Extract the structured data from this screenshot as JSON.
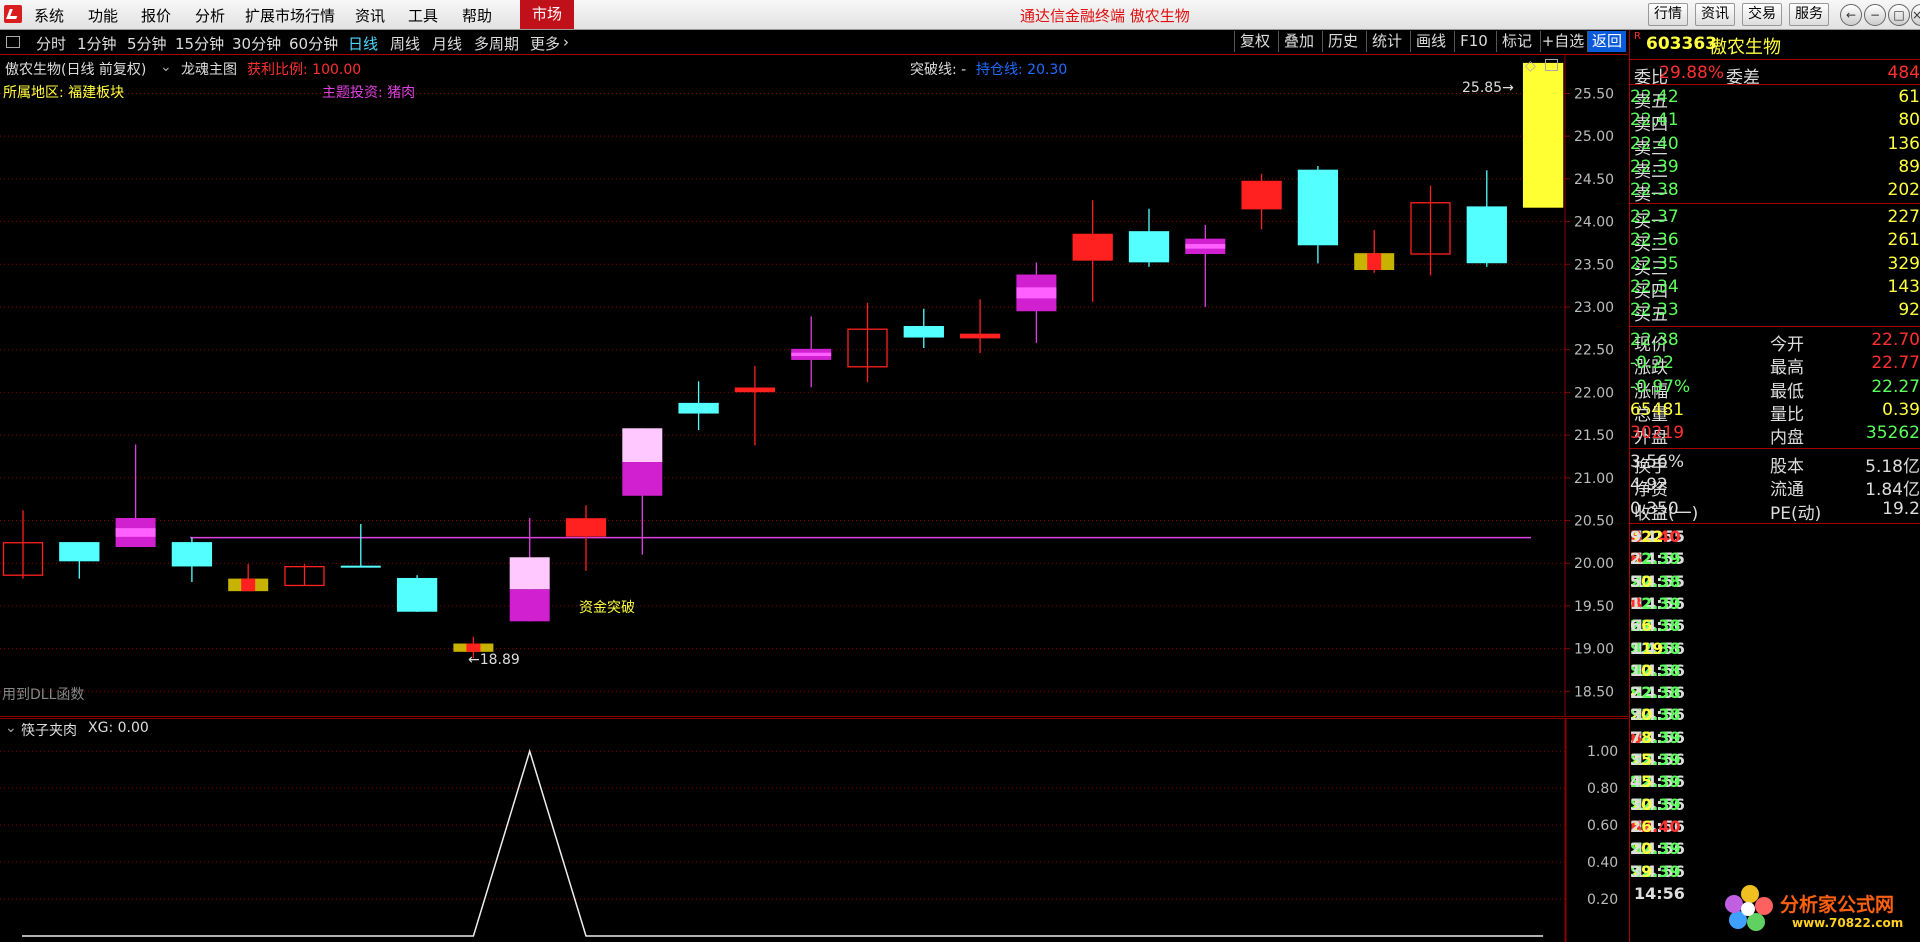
{
  "menu": {
    "items": [
      "系统",
      "功能",
      "报价",
      "分析",
      "扩展市场行情",
      "资讯",
      "工具",
      "帮助"
    ],
    "market_tab": "市场"
  },
  "app_title": "通达信金融终端  傲农生物",
  "top_right_buttons": [
    "行情",
    "资讯",
    "交易",
    "服务"
  ],
  "period_toolbar": {
    "items": [
      "分时",
      "1分钟",
      "5分钟",
      "15分钟",
      "30分钟",
      "60分钟",
      "日线",
      "周线",
      "月线",
      "多周期",
      "更多"
    ],
    "active": "日线"
  },
  "tool_buttons": {
    "items": [
      "复权",
      "叠加",
      "历史",
      "统计",
      "画线",
      "F10",
      "标记",
      "+自选",
      "返回"
    ],
    "active": "返回"
  },
  "chart_header": {
    "stock": "傲农生物(日线 前复权)",
    "main_formula": "龙魂主图",
    "profit_label": "获利比例: 100.00",
    "breakout_label": "突破线: -",
    "hold_label": "持仓线: 20.30",
    "region": "所属地区: 福建板块",
    "theme": "主题投资: 猪肉"
  },
  "annotations": {
    "capital_breakout": "资金突破",
    "low_marker": "←18.89",
    "high_marker": "25.85→",
    "dll_note": "用到DLL函数"
  },
  "subchart": {
    "name": "筷子夹肉",
    "value_label": "XG: 0.00"
  },
  "colors": {
    "up": "#ff2020",
    "down": "#54ffff",
    "magenta": "#e040e0",
    "yellow": "#ffff33",
    "grid": "#8b0000"
  },
  "chart_data": [
    {
      "type": "candlestick",
      "ylim": [
        18.2,
        25.95
      ],
      "yticks": [
        "25.50",
        "25.00",
        "24.50",
        "24.00",
        "23.50",
        "23.00",
        "22.50",
        "22.00",
        "21.50",
        "21.00",
        "20.50",
        "20.00",
        "19.50",
        "19.00",
        "18.50"
      ],
      "hold_line": 20.3,
      "candles": [
        {
          "o": 19.86,
          "c": 20.24,
          "h": 20.62,
          "l": 19.82,
          "style": "up-hollow"
        },
        {
          "o": 20.24,
          "c": 20.03,
          "h": 20.24,
          "l": 19.82,
          "style": "cyan"
        },
        {
          "o": 20.19,
          "c": 20.53,
          "h": 21.39,
          "l": 20.19,
          "style": "magenta"
        },
        {
          "o": 20.24,
          "c": 19.97,
          "h": 20.3,
          "l": 19.78,
          "style": "cyan"
        },
        {
          "o": 19.72,
          "c": 19.82,
          "h": 19.99,
          "l": 19.72,
          "style": "yellow-red"
        },
        {
          "o": 19.74,
          "c": 19.96,
          "h": 19.99,
          "l": 19.74,
          "style": "up-hollow"
        },
        {
          "o": 19.96,
          "c": 19.96,
          "h": 20.46,
          "l": 19.96,
          "style": "cyan-doji"
        },
        {
          "o": 19.82,
          "c": 19.44,
          "h": 19.86,
          "l": 19.43,
          "style": "cyan"
        },
        {
          "o": 19.01,
          "c": 19.06,
          "h": 19.14,
          "l": 18.89,
          "style": "yellow-red"
        },
        {
          "o": 19.32,
          "c": 20.07,
          "h": 20.53,
          "l": 19.32,
          "style": "pink-magenta"
        },
        {
          "o": 20.32,
          "c": 20.52,
          "h": 20.68,
          "l": 19.91,
          "style": "up"
        },
        {
          "o": 20.79,
          "c": 21.58,
          "h": 21.58,
          "l": 20.1,
          "style": "pink-magenta"
        },
        {
          "o": 21.87,
          "c": 21.76,
          "h": 22.13,
          "l": 21.56,
          "style": "cyan"
        },
        {
          "o": 22.01,
          "c": 22.05,
          "h": 22.31,
          "l": 21.38,
          "style": "up"
        },
        {
          "o": 22.38,
          "c": 22.51,
          "h": 22.89,
          "l": 22.06,
          "style": "magenta"
        },
        {
          "o": 22.3,
          "c": 22.74,
          "h": 23.05,
          "l": 22.12,
          "style": "up-hollow"
        },
        {
          "o": 22.77,
          "c": 22.65,
          "h": 22.98,
          "l": 22.52,
          "style": "cyan"
        },
        {
          "o": 22.64,
          "c": 22.68,
          "h": 23.09,
          "l": 22.46,
          "style": "up"
        },
        {
          "o": 22.95,
          "c": 23.38,
          "h": 23.52,
          "l": 22.58,
          "style": "magenta"
        },
        {
          "o": 23.55,
          "c": 23.85,
          "h": 24.25,
          "l": 23.06,
          "style": "up"
        },
        {
          "o": 23.88,
          "c": 23.53,
          "h": 24.15,
          "l": 23.47,
          "style": "cyan"
        },
        {
          "o": 23.62,
          "c": 23.8,
          "h": 23.96,
          "l": 23.0,
          "style": "magenta"
        },
        {
          "o": 24.15,
          "c": 24.47,
          "h": 24.56,
          "l": 23.91,
          "style": "up"
        },
        {
          "o": 24.6,
          "c": 23.73,
          "h": 24.65,
          "l": 23.51,
          "style": "cyan"
        },
        {
          "o": 23.48,
          "c": 23.63,
          "h": 23.9,
          "l": 23.4,
          "style": "yellow-red"
        },
        {
          "o": 23.62,
          "c": 24.22,
          "h": 24.42,
          "l": 23.37,
          "style": "up-hollow"
        },
        {
          "o": 24.17,
          "c": 23.52,
          "h": 24.6,
          "l": 23.47,
          "style": "cyan"
        },
        {
          "o": 24.17,
          "c": 25.85,
          "h": 25.85,
          "l": 24.17,
          "style": "yellow"
        }
      ]
    },
    {
      "type": "line",
      "series": [
        {
          "name": "XG",
          "values": [
            0,
            0,
            0,
            0,
            0,
            0,
            0,
            0,
            0,
            1,
            0,
            0,
            0,
            0,
            0,
            0,
            0,
            0,
            0,
            0,
            0,
            0,
            0,
            0,
            0,
            0,
            0,
            0
          ]
        }
      ],
      "ylim": [
        0,
        1.05
      ],
      "yticks": [
        "1.00",
        "0.80",
        "0.60",
        "0.40",
        "0.20"
      ]
    }
  ],
  "quote": {
    "code": "603363",
    "name": "傲农生物",
    "ratio": {
      "label": "委比",
      "value": "29.88%",
      "diff_label": "委差",
      "diff_value": "484"
    },
    "sells": [
      {
        "label": "卖五",
        "price": "22.42",
        "vol": "61"
      },
      {
        "label": "卖四",
        "price": "22.41",
        "vol": "80"
      },
      {
        "label": "卖三",
        "price": "22.40",
        "vol": "136"
      },
      {
        "label": "卖二",
        "price": "22.39",
        "vol": "89"
      },
      {
        "label": "卖一",
        "price": "22.38",
        "vol": "202"
      }
    ],
    "buys": [
      {
        "label": "买一",
        "price": "22.37",
        "vol": "227"
      },
      {
        "label": "买二",
        "price": "22.36",
        "vol": "261"
      },
      {
        "label": "买三",
        "price": "22.35",
        "vol": "329"
      },
      {
        "label": "买四",
        "price": "22.34",
        "vol": "143"
      },
      {
        "label": "买五",
        "price": "22.33",
        "vol": "92"
      }
    ],
    "stats": [
      {
        "l1": "现价",
        "v1": "22.38",
        "c1": "#5cff5c",
        "l2": "今开",
        "v2": "22.70",
        "c2": "#ff3030"
      },
      {
        "l1": "涨跌",
        "v1": "-0.22",
        "c1": "#5cff5c",
        "l2": "最高",
        "v2": "22.77",
        "c2": "#ff3030"
      },
      {
        "l1": "涨幅",
        "v1": "-0.97%",
        "c1": "#5cff5c",
        "l2": "最低",
        "v2": "22.27",
        "c2": "#5cff5c"
      },
      {
        "l1": "总量",
        "v1": "65481",
        "c1": "#ffff40",
        "l2": "量比",
        "v2": "0.39",
        "c2": "#ffff40"
      },
      {
        "l1": "外盘",
        "v1": "30219",
        "c1": "#ff3030",
        "l2": "内盘",
        "v2": "35262",
        "c2": "#5cff5c"
      }
    ],
    "fund": [
      {
        "l1": "换手",
        "v1": "3.56%",
        "l2": "股本",
        "v2": "5.18亿"
      },
      {
        "l1": "净资",
        "v1": "4.92",
        "l2": "流通",
        "v2": "1.84亿"
      },
      {
        "l1": "收益(一)",
        "v1": "0.350",
        "l2": "PE(动)",
        "v2": "19.2"
      }
    ],
    "ticks": [
      {
        "t": "14:55",
        "p": "22.40",
        "v": "122",
        "s": "B",
        "n": "9"
      },
      {
        "t": "14:55",
        "p": "22.39",
        "v": "3",
        "s": "B",
        "n": "2"
      },
      {
        "t": "14:55",
        "p": "22.38",
        "v": "50",
        "s": "S",
        "n": "5"
      },
      {
        "t": "14:56",
        "p": "22.39",
        "v": "6",
        "s": "B",
        "n": "1"
      },
      {
        "t": "14:56",
        "p": "22.38",
        "v": "66",
        "s": "S",
        "n": "6"
      },
      {
        "t": "14:56",
        "p": "22.38",
        "v": "119",
        "s": "S",
        "n": "13"
      },
      {
        "t": "14:56",
        "p": "22.38",
        "v": "10",
        "s": "S",
        "n": "1"
      },
      {
        "t": "14:56",
        "p": "22.38",
        "v": "8",
        "s": "S",
        "n": "2"
      },
      {
        "t": "14:56",
        "p": "22.38",
        "v": "20",
        "s": "S",
        "n": "3"
      },
      {
        "t": "14:56",
        "p": "22.39",
        "v": "38",
        "s": "B",
        "n": "7"
      },
      {
        "t": "14:56",
        "p": "22.39",
        "v": "15",
        "s": "S",
        "n": "3"
      },
      {
        "t": "14:56",
        "p": "22.39",
        "v": "45",
        "s": "S",
        "n": "4"
      },
      {
        "t": "14:56",
        "p": "22.39",
        "v": "10",
        "s": "S",
        "n": "3"
      },
      {
        "t": "14:56",
        "p": "22.40",
        "v": "16",
        "s": "B",
        "n": "2"
      },
      {
        "t": "14:56",
        "p": "22.39",
        "v": "10",
        "s": "S",
        "n": "2"
      },
      {
        "t": "14:56",
        "p": "22.39",
        "v": "79",
        "s": "S",
        "n": "3"
      },
      {
        "t": "14:56",
        "p": "",
        "v": "",
        "s": "",
        "n": ""
      }
    ]
  },
  "watermark": {
    "line1": "分析家公式网",
    "line2": "www.70822.com"
  }
}
